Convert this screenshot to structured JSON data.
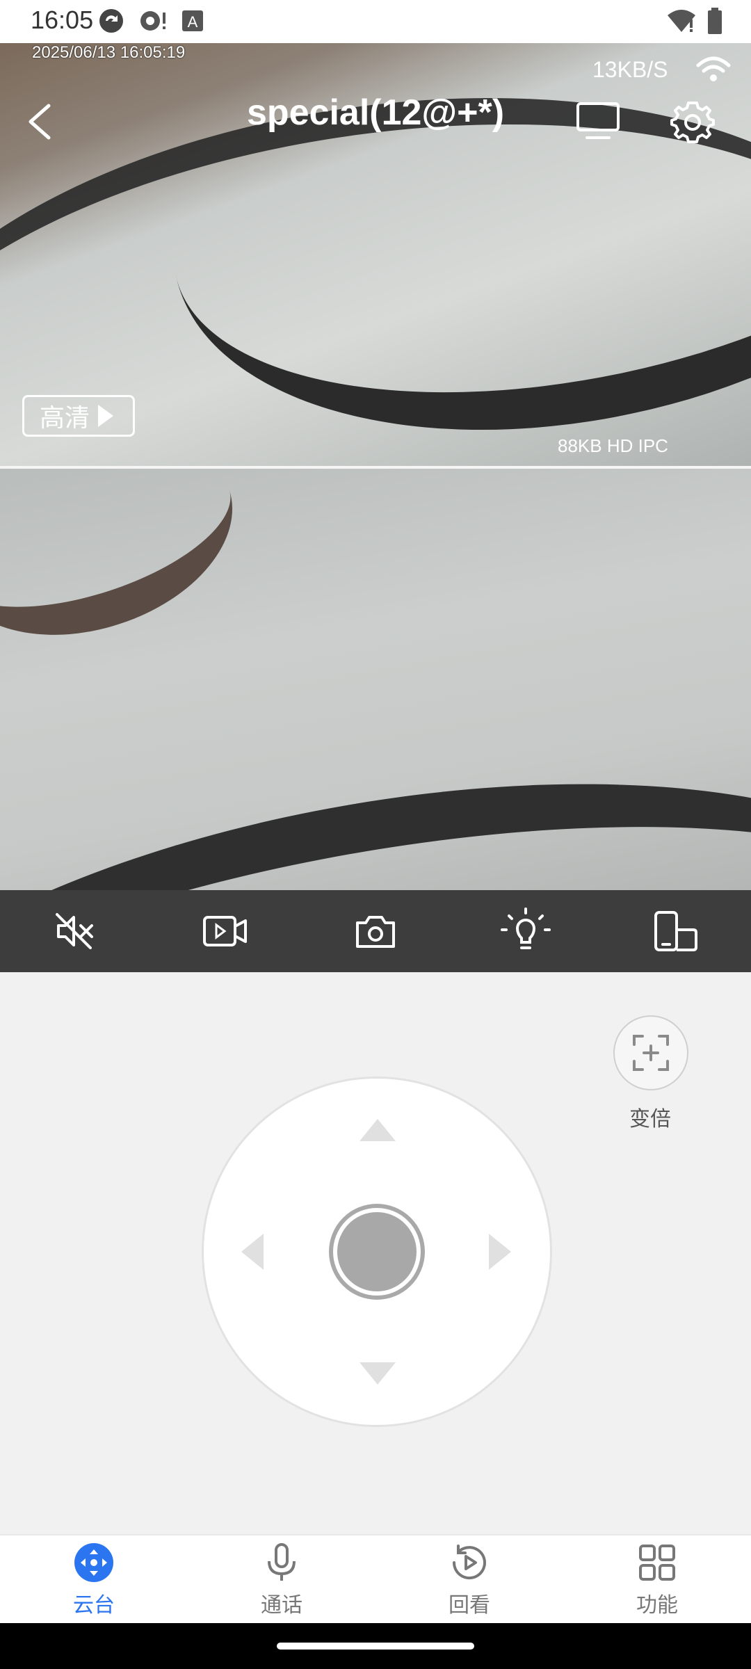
{
  "status_bar": {
    "time": "16:05",
    "icons": [
      "sync-icon",
      "camera-notify-icon",
      "a-box-icon",
      "wifi-alert-icon",
      "battery-icon"
    ]
  },
  "video": {
    "osd_timestamp": "2025/06/13 16:05:19",
    "net_speed": "13KB/S",
    "title": "special(12@+*)",
    "quality_label": "高清",
    "camera_info": "88KB HD IPC"
  },
  "toolbar": {
    "items": [
      "mute-icon",
      "record-icon",
      "snapshot-icon",
      "light-icon",
      "orientation-icon"
    ]
  },
  "controls": {
    "zoom_label": "变倍"
  },
  "bottom_nav": {
    "items": [
      {
        "label": "云台",
        "icon": "ptz-icon",
        "active": true
      },
      {
        "label": "通话",
        "icon": "microphone-icon",
        "active": false
      },
      {
        "label": "回看",
        "icon": "playback-icon",
        "active": false
      },
      {
        "label": "功能",
        "icon": "grid-icon",
        "active": false
      }
    ]
  },
  "colors": {
    "accent": "#2b75f0",
    "toolbar_bg": "#3d3d3d"
  }
}
